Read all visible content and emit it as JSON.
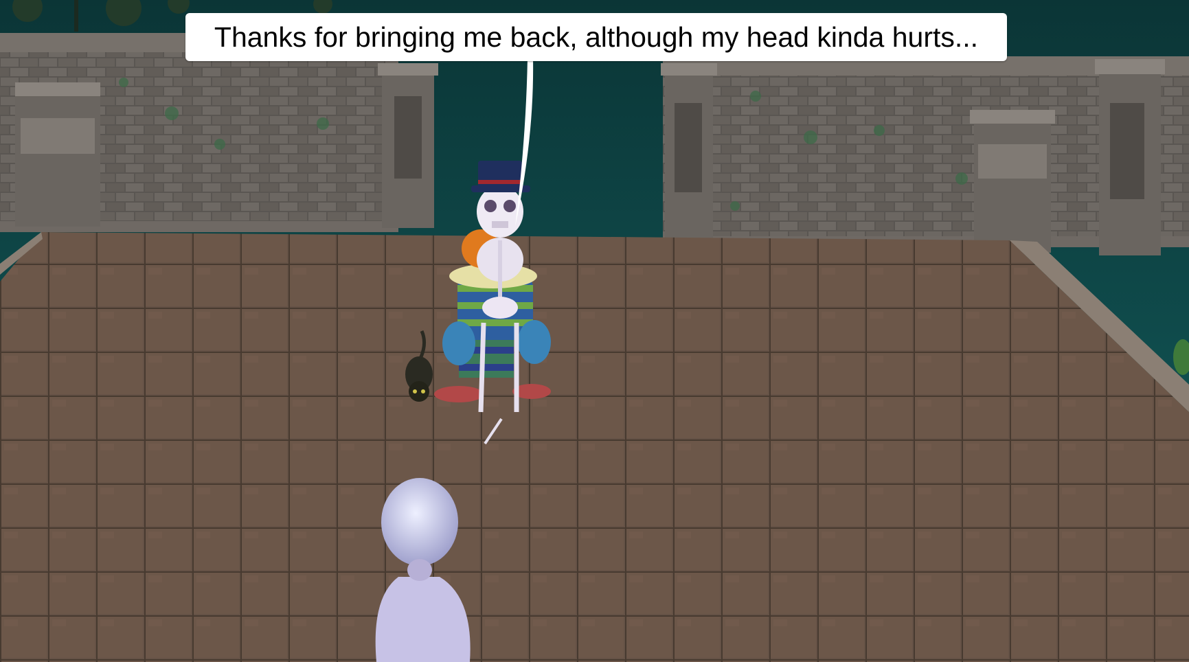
{
  "dialogue": {
    "text": "Thanks for bringing me back, although my head kinda hurts..."
  },
  "scene": {
    "setting": "stone-courtyard",
    "characters": [
      "skeleton-clown-npc",
      "black-cat-pet",
      "player-avatar"
    ]
  }
}
